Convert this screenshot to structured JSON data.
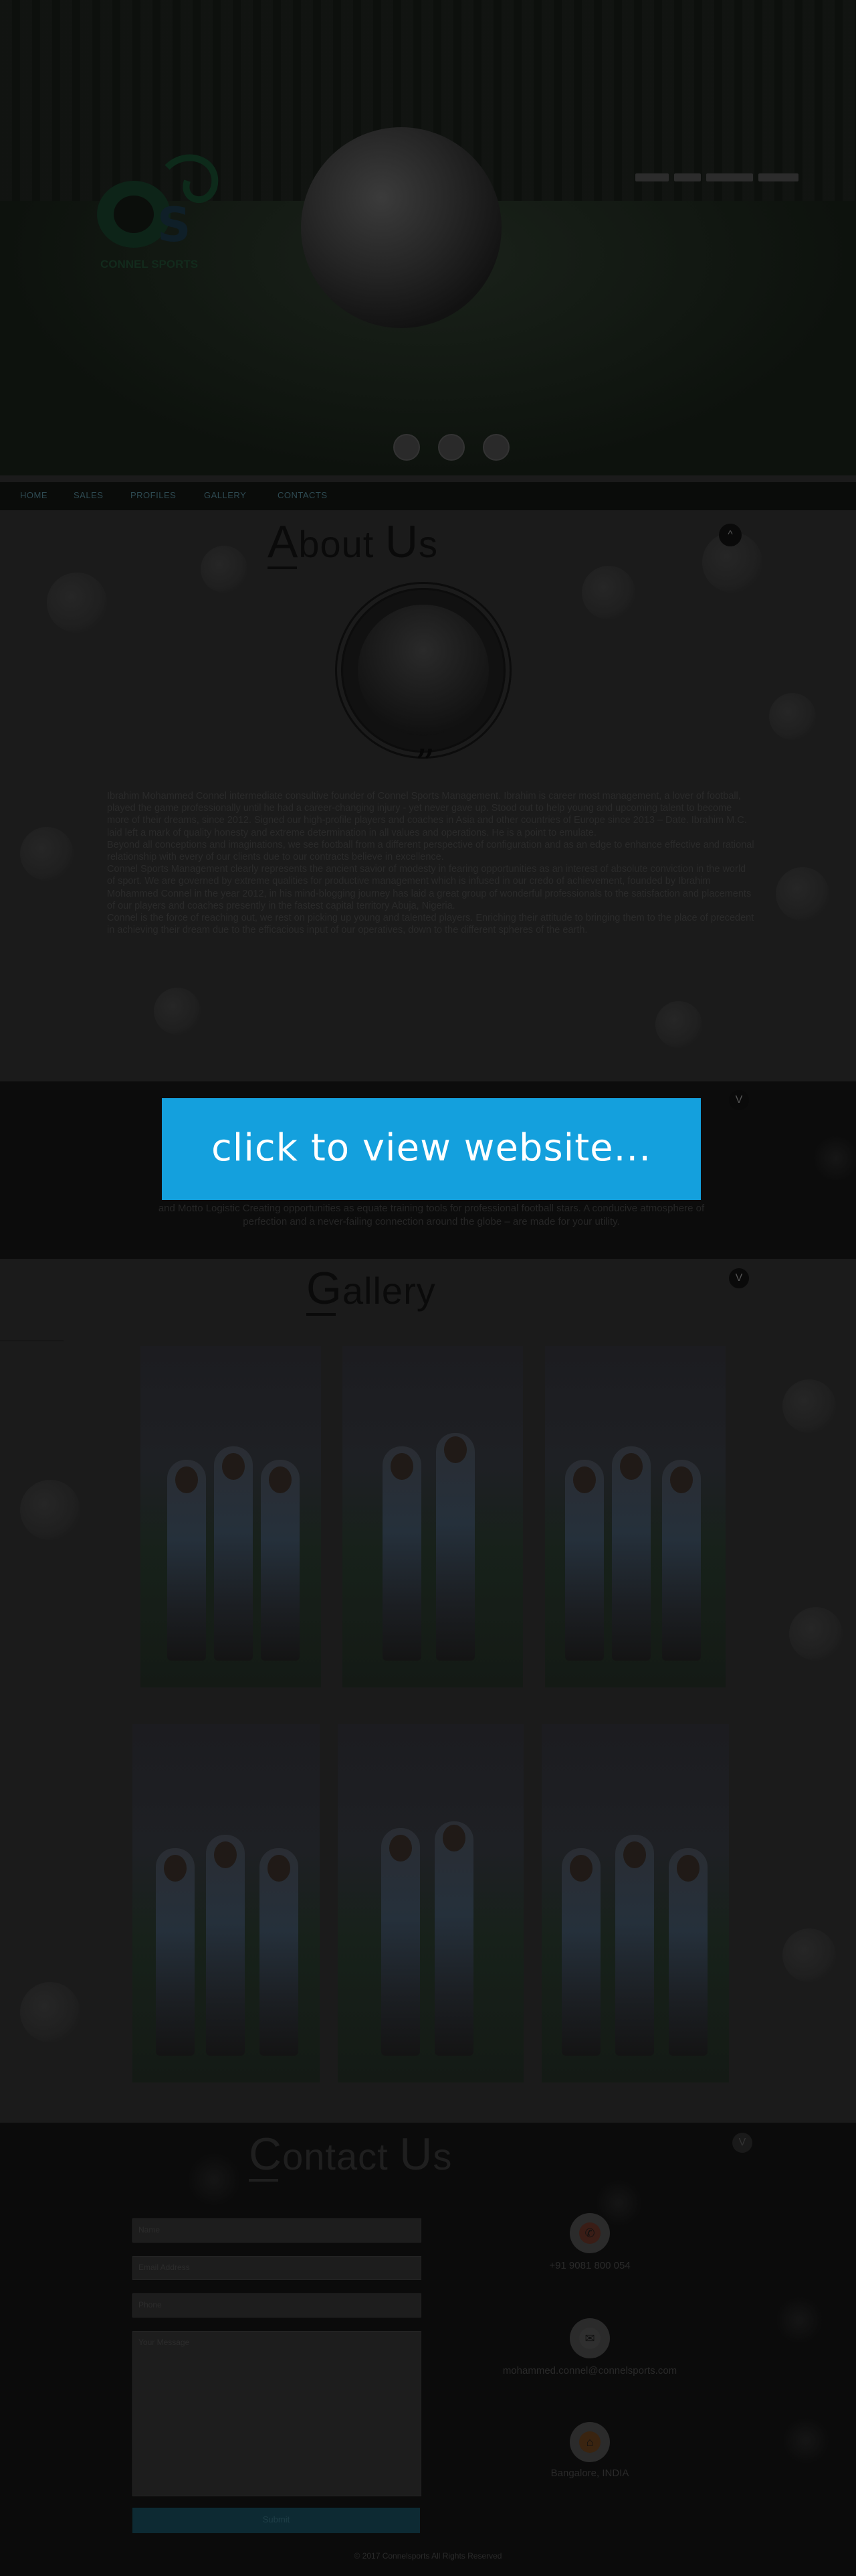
{
  "nav": {
    "items": [
      "HOME",
      "SALES",
      "PROFILES",
      "GALLERY",
      "CONTACTS"
    ]
  },
  "about": {
    "title_cap1": "A",
    "title_rest1": "bout ",
    "title_cap2": "U",
    "title_rest2": "s",
    "toggle": "^",
    "quote_mark": "”",
    "paragraphs": [
      "Ibrahim Mohammed Connel intermediate consultive founder of Connel Sports Management. Ibrahim is career most management, a lover of football, played the game professionally until he had a career-changing injury - yet never gave up. Stood out to help young and upcoming talent to become more of their dreams, since 2012. Signed our high-profile players and coaches in Asia and other countries of Europe since 2013 – Date. Ibrahim M.C. laid left a mark of quality honesty and extreme determination in all values and operations. He is a point to emulate.",
      "Beyond all conceptions and imaginations, we see football from a different perspective of configuration and as an edge to enhance effective and rational relationship with every of our clients due to our contracts believe in excellence.",
      "Connel Sports Management clearly represents the ancient savior of modesty in fearing opportunities as an interest of absolute conviction in the world of sport. We are governed by extreme qualities for productive management which is infused in our credo of achievement, founded by Ibrahim Mohammed Connel in the year 2012, in his mind-blogging journey has laid a great group of wonderful professionals to the satisfaction and placements of our players and coaches presently in the fastest capital territory Abuja, Nigeria.",
      "Connel is the force of reaching out, we rest on picking up young and talented players. Enriching their attitude to bringing them to the place of precedent in achieving their dream due to the efficacious input of our operatives, down to the different spheres of the earth."
    ]
  },
  "mission": {
    "toggle": "V",
    "text": "and Motto Logistic Creating opportunities as equate training tools for professional football stars. A conducive atmosphere of perfection and a never-failing connection around the globe – are made for your utility."
  },
  "cta": {
    "label": "click to view website..."
  },
  "gallery": {
    "title_cap": "G",
    "title_rest": "allery",
    "toggle": "V"
  },
  "contact": {
    "title_cap1": "C",
    "title_rest1": "ontact ",
    "title_cap2": "U",
    "title_rest2": "s",
    "toggle": "V",
    "form": {
      "name_placeholder": "Name",
      "email_placeholder": "Email Address",
      "phone_placeholder": "Phone",
      "message_placeholder": "Your Message",
      "submit_label": "Submit"
    },
    "phone": "+91 9081 800 054",
    "email": "mohammed.connel@connelsports.com",
    "location": "Bangalore, INDIA",
    "copyright": "© 2017 Connelsports All Rights Reserved"
  }
}
